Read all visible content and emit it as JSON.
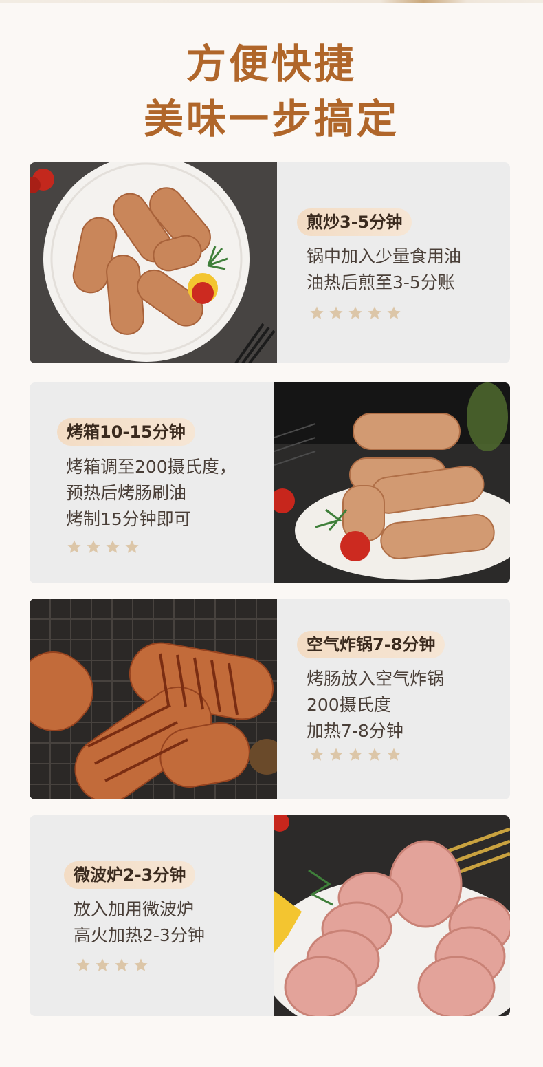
{
  "headline": {
    "line1": "方便快捷",
    "line2": "美味一步搞定"
  },
  "methods": [
    {
      "title": "煎炒3-5分钟",
      "lines": [
        "锅中加入少量食用油",
        "油热后煎至3-5分账"
      ],
      "stars": 5
    },
    {
      "title": "烤箱10-15分钟",
      "lines": [
        "烤箱调至200摄氏度，",
        "预热后烤肠刷油",
        "烤制15分钟即可"
      ],
      "stars": 4
    },
    {
      "title": "空气炸锅7-8分钟",
      "lines": [
        "烤肠放入空气炸锅",
        "200摄氏度",
        "加热7-8分钟"
      ],
      "stars": 5
    },
    {
      "title": "微波炉2-3分钟",
      "lines": [
        "放入加用微波炉",
        "高火加热2-3分钟"
      ],
      "stars": 4
    }
  ],
  "colors": {
    "headline": "#b0662a",
    "badge": "#f3dcc4",
    "card": "#ececec",
    "star": "#dcc6a8"
  }
}
